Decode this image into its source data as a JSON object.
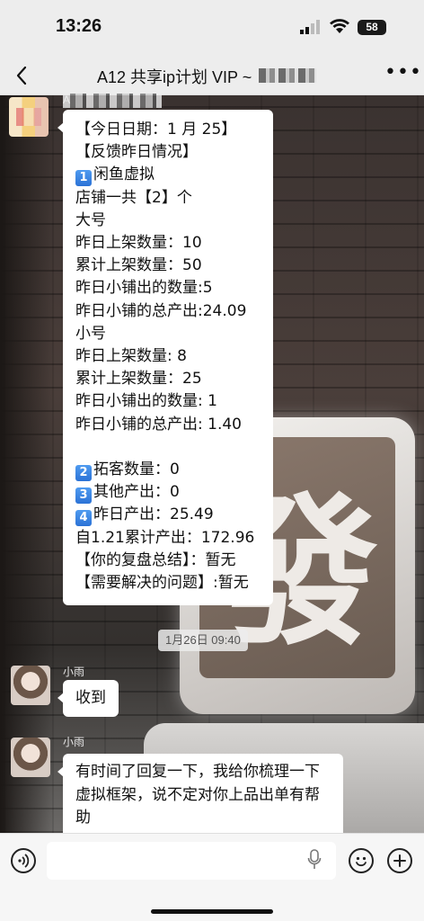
{
  "status_bar": {
    "time": "13:26",
    "battery": "58"
  },
  "nav": {
    "title": "A12 共享ip计划 VIP ~"
  },
  "messages": {
    "first": {
      "sender": "A",
      "lines": [
        "【今日日期：1 月 25】",
        "【反馈昨日情况】",
        "闲鱼虚拟",
        "店铺一共【2】个",
        "大号",
        "昨日上架数量：10",
        "累计上架数量：50",
        "昨日小铺出的数量:5",
        "昨日小铺的总产出:24.09",
        "小号",
        "昨日上架数量: 8",
        "累计上架数量：25",
        "昨日小铺出的数量: 1",
        "昨日小铺的总产出: 1.40",
        "",
        "拓客数量：0",
        "其他产出：0",
        "昨日产出：25.49",
        "自1.21累计产出：172.96",
        "【你的复盘总结】：暂无",
        "【需要解决的问题】:暂无"
      ],
      "keycaps": [
        "1",
        "2",
        "3",
        "4"
      ]
    },
    "timestamp": "1月26日 09:40",
    "second": {
      "sender": "小雨",
      "text": "收到"
    },
    "third": {
      "sender": "小雨",
      "text": "有时间了回复一下，我给你梳理一下虚拟框架，说不定对你上品出单有帮助"
    }
  },
  "background": {
    "sign_char": "發"
  },
  "colors": {
    "bubble": "#ffffff",
    "keycap": "#3f86e6",
    "bar_bg": "#ededed"
  }
}
